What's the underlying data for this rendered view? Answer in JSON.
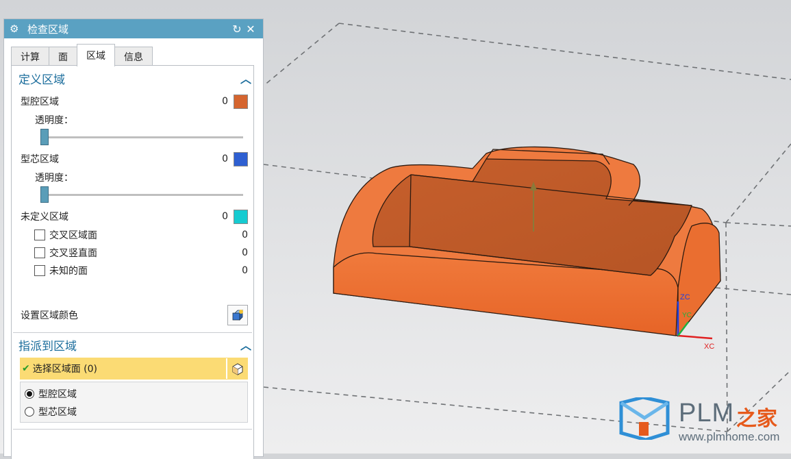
{
  "dialog": {
    "title": "检查区域",
    "icons": {
      "settings": "gear-icon",
      "reset": "reset-icon",
      "close": "close-icon"
    }
  },
  "tabs": [
    {
      "label": "计算",
      "active": false
    },
    {
      "label": "面",
      "active": false
    },
    {
      "label": "区域",
      "active": true
    },
    {
      "label": "信息",
      "active": false
    }
  ],
  "define_region": {
    "header": "定义区域",
    "cavity": {
      "label": "型腔区域",
      "count": "0",
      "color": "#d5652f"
    },
    "cavity_transparency_label": "透明度：",
    "cavity_transparency": 0,
    "core": {
      "label": "型芯区域",
      "count": "0",
      "color": "#2e5fd1"
    },
    "core_transparency_label": "透明度：",
    "core_transparency": 0,
    "undefined": {
      "label": "未定义区域",
      "count": "0",
      "color": "#16cbd1"
    },
    "checks": [
      {
        "label": "交叉区域面",
        "count": "0",
        "checked": false
      },
      {
        "label": "交叉竖直面",
        "count": "0",
        "checked": false
      },
      {
        "label": "未知的面",
        "count": "0",
        "checked": false
      }
    ],
    "set_color_label": "设置区域颜色"
  },
  "assign_region": {
    "header": "指派到区域",
    "select_faces_label": "选择区域面 (0)",
    "options": [
      {
        "label": "型腔区域",
        "selected": true
      },
      {
        "label": "型芯区域",
        "selected": false
      }
    ]
  },
  "viewport": {
    "axis_x": "XC",
    "axis_z": "ZC",
    "axis_y": "YC",
    "part_color": "#e66a2c"
  },
  "watermark": {
    "brand": "PLM",
    "brand_cn": "之家",
    "url": "www.plmhome.com"
  }
}
